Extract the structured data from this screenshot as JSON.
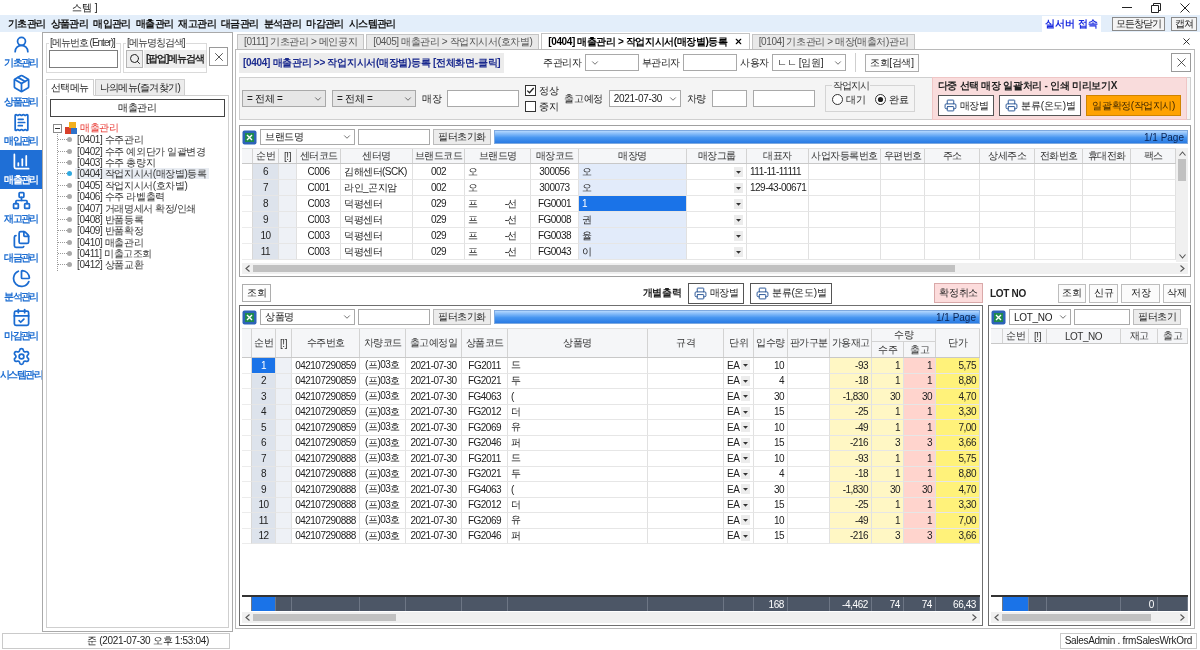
{
  "window": {
    "title": "스템 ]"
  },
  "menu_bar": {
    "items": [
      "기초관리",
      "상품관리",
      "매입관리",
      "매출관리",
      "재고관리",
      "대금관리",
      "분석관리",
      "마감관리",
      "시스템관리"
    ],
    "server_status": "실서버 접속",
    "buttons": [
      "모든창닫기",
      "캡쳐"
    ]
  },
  "nav_rail": [
    {
      "label": "기초관리",
      "selected": false
    },
    {
      "label": "상품관리",
      "selected": false
    },
    {
      "label": "매입관리",
      "selected": false
    },
    {
      "label": "매출관리",
      "selected": true
    },
    {
      "label": "재고관리",
      "selected": false
    },
    {
      "label": "대금관리",
      "selected": false
    },
    {
      "label": "분석관리",
      "selected": false
    },
    {
      "label": "마감관리",
      "selected": false
    },
    {
      "label": "시스템관리",
      "selected": false
    }
  ],
  "menu_panel": {
    "number_search": {
      "legend": "[메뉴번호 (Enter)]"
    },
    "name_search": {
      "legend": "[메뉴명칭검색]",
      "button": "[팝업]메뉴검색"
    },
    "tabs": [
      {
        "label": "선택메뉴",
        "selected": true
      },
      {
        "label": "나의메뉴(즐겨찾기)",
        "selected": false
      }
    ],
    "group_button": "매출관리",
    "tree": {
      "label": "매출관리",
      "expanded": true,
      "children": [
        {
          "label": "[0401] 수주관리",
          "selected": false
        },
        {
          "label": "[0402] 수주 예외단가 일괄변경",
          "selected": false
        },
        {
          "label": "[0403] 수주 총량지",
          "selected": false
        },
        {
          "label": "[0404] 작업지시서(매장별)등록",
          "selected": true
        },
        {
          "label": "[0405] 작업지시서(호차별)",
          "selected": false
        },
        {
          "label": "[0406] 수주 라벨출력",
          "selected": false
        },
        {
          "label": "[0407] 거래명세서 확정/인쇄",
          "selected": false
        },
        {
          "label": "[0408] 반품등록",
          "selected": false
        },
        {
          "label": "[0409] 반품확정",
          "selected": false
        },
        {
          "label": "[0410] 매출관리",
          "selected": false
        },
        {
          "label": "[0411] 미출고조회",
          "selected": false
        },
        {
          "label": "[0412] 상품교환",
          "selected": false
        }
      ]
    }
  },
  "doc_tabs": [
    {
      "label": "[0111] 기초관리 > 메인공지",
      "selected": false
    },
    {
      "label": "[0405] 매출관리 > 작업지시서(호차별)",
      "selected": false
    },
    {
      "label": "[0404] 매출관리 > 작업지시서(매장별)등록",
      "selected": true
    },
    {
      "label": "[0104] 기초관리 > 매장(매출처)관리",
      "selected": false
    }
  ],
  "form_header": {
    "title": "[0404] 매출관리 >> 작업지시서(매장별)등록 [전체화면-클릭]",
    "main_manager_label": "주관리자",
    "sub_manager_label": "부관리자",
    "user": {
      "label": "사용자",
      "value": "ㄴㄴ [임원]"
    },
    "search_button": "조회[검색]"
  },
  "filters": {
    "selects": [
      "= 전체 =",
      "= 전체 ="
    ],
    "store_label": "매장",
    "status": [
      {
        "label": "정상",
        "checked": true
      },
      {
        "label": "중지",
        "checked": false
      }
    ],
    "ship_date": {
      "label": "출고예정",
      "value": "2021-07-30"
    },
    "vehicle_label": "차량",
    "work_order": {
      "legend": "작업지시",
      "options": [
        {
          "label": "대기",
          "selected": false
        },
        {
          "label": "완료",
          "selected": true
        }
      ]
    }
  },
  "batch_panel": {
    "title": "다중 선택 매장 일괄처리 - 인쇄 미리보기X",
    "buttons": [
      {
        "label": "매장별",
        "kind": "print"
      },
      {
        "label": "분류(온도)별",
        "kind": "print"
      },
      {
        "label": "일괄확정(작업지시)",
        "kind": "confirm"
      }
    ]
  },
  "store_grid": {
    "filter_field": "브랜드명",
    "reset_button": "필터초기화",
    "page": "1/1 Page",
    "columns": [
      {
        "label": "순번",
        "kind": "index",
        "current": false
      },
      {
        "label": "[!]",
        "kind": "flag",
        "current": false
      },
      {
        "label": "센터코드",
        "kind": "code",
        "current": false
      },
      {
        "label": "센터명",
        "kind": "text",
        "current": false
      },
      {
        "label": "브랜드코드",
        "kind": "code",
        "current": false
      },
      {
        "label": "브랜드명",
        "kind": "text",
        "current": false
      },
      {
        "label": "매장코드",
        "kind": "code",
        "current": false
      },
      {
        "label": "매장명",
        "kind": "text",
        "current": true
      },
      {
        "label": "매장그룹",
        "kind": "dropdown",
        "current": false
      },
      {
        "label": "대표자",
        "kind": "text",
        "current": false
      },
      {
        "label": "사업자등록번호",
        "kind": "text",
        "current": false
      },
      {
        "label": "우편번호",
        "kind": "text",
        "current": false
      },
      {
        "label": "주소",
        "kind": "text",
        "current": false
      },
      {
        "label": "상세주소",
        "kind": "text",
        "current": false
      },
      {
        "label": "전화번호",
        "kind": "text",
        "current": false
      },
      {
        "label": "휴대전화",
        "kind": "text",
        "current": false
      },
      {
        "label": "팩스",
        "kind": "text",
        "current": false
      }
    ],
    "rows": [
      {
        "selected": false,
        "cells": [
          "6",
          null,
          "C006",
          "김해센터(SCK)",
          "002",
          "오",
          "300056",
          "오",
          null,
          "111-11-11111"
        ]
      },
      {
        "selected": false,
        "cells": [
          "7",
          null,
          "C001",
          "라인_곤지암",
          "002",
          "오",
          "300073",
          "오",
          null,
          "129-43-00671"
        ]
      },
      {
        "selected": true,
        "cells": [
          "8",
          null,
          "C003",
          "덕평센터",
          "029",
          {
            "text": "프",
            "tail": "-선"
          },
          "FG0001",
          "1"
        ]
      },
      {
        "selected": false,
        "cells": [
          "9",
          null,
          "C003",
          "덕평센터",
          "029",
          {
            "text": "프",
            "tail": "-선"
          },
          "FG0008",
          "권"
        ]
      },
      {
        "selected": false,
        "cells": [
          "10",
          null,
          "C003",
          "덕평센터",
          "029",
          {
            "text": "프",
            "tail": "-선"
          },
          "FG0038",
          "율"
        ]
      },
      {
        "selected": false,
        "cells": [
          "11",
          null,
          "C003",
          "덕평센터",
          "029",
          {
            "text": "프",
            "tail": "-선"
          },
          "FG0043",
          "이"
        ]
      }
    ]
  },
  "order_actions": {
    "query_button": "조회",
    "print_label": "개별출력",
    "print_buttons": [
      "매장별",
      "분류(온도)별"
    ],
    "cancel_button": "확정취소"
  },
  "order_grid": {
    "filter_field": "상품명",
    "reset_button": "필터초기화",
    "page": "1/1 Page",
    "column_group": {
      "label": "수량"
    },
    "columns": [
      {
        "label": "순번",
        "kind": "index",
        "current": true
      },
      {
        "label": "[!]",
        "kind": "flag",
        "current": false
      },
      {
        "label": "수주번호",
        "kind": "code",
        "current": false
      },
      {
        "label": "차량코드",
        "kind": "code",
        "current": false
      },
      {
        "label": "출고예정일",
        "kind": "code",
        "current": false
      },
      {
        "label": "상품코드",
        "kind": "code",
        "current": false
      },
      {
        "label": "상품명",
        "kind": "text",
        "current": false
      },
      {
        "label": "규격",
        "kind": "text",
        "current": false
      },
      {
        "label": "단위",
        "kind": "dropdown",
        "current": false
      },
      {
        "label": "입수량",
        "kind": "number",
        "current": false,
        "total": "168"
      },
      {
        "label": "판가구분",
        "kind": "text",
        "current": false
      },
      {
        "label": "가용재고",
        "kind": "stock",
        "current": false,
        "total": "-4,462"
      },
      {
        "label": "수주",
        "kind": "order",
        "current": false,
        "grouped": true,
        "total": "74"
      },
      {
        "label": "출고",
        "kind": "ship",
        "current": false,
        "grouped": true,
        "total": "74"
      },
      {
        "label": "단가",
        "kind": "price",
        "current": false,
        "total": "66,43"
      }
    ],
    "rows": [
      {
        "selected": true,
        "cells": [
          "1",
          null,
          "042107290859",
          "(프)03호",
          "2021-07-30",
          "FG2011",
          "드",
          null,
          "EA",
          "10",
          null,
          "-93",
          "1",
          "1",
          "5,75"
        ]
      },
      {
        "selected": false,
        "cells": [
          "2",
          null,
          "042107290859",
          "(프)03호",
          "2021-07-30",
          "FG2021",
          "두",
          null,
          "EA",
          "4",
          null,
          "-18",
          "1",
          "1",
          "8,80"
        ]
      },
      {
        "selected": false,
        "cells": [
          "3",
          null,
          "042107290859",
          "(프)03호",
          "2021-07-30",
          "FG4063",
          "(",
          null,
          "EA",
          "30",
          null,
          "-1,830",
          "30",
          "30",
          "4,70"
        ]
      },
      {
        "selected": false,
        "cells": [
          "4",
          null,
          "042107290859",
          "(프)03호",
          "2021-07-30",
          "FG2012",
          "더",
          null,
          "EA",
          "15",
          null,
          "-25",
          "1",
          "1",
          "3,30"
        ]
      },
      {
        "selected": false,
        "cells": [
          "5",
          null,
          "042107290859",
          "(프)03호",
          "2021-07-30",
          "FG2069",
          "유",
          null,
          "EA",
          "10",
          null,
          "-49",
          "1",
          "1",
          "7,00"
        ]
      },
      {
        "selected": false,
        "cells": [
          "6",
          null,
          "042107290859",
          "(프)03호",
          "2021-07-30",
          "FG2046",
          "퍼",
          null,
          "EA",
          "15",
          null,
          "-216",
          "3",
          "3",
          "3,66"
        ]
      },
      {
        "selected": false,
        "cells": [
          "7",
          null,
          "042107290888",
          "(프)03호",
          "2021-07-30",
          "FG2011",
          "드",
          null,
          "EA",
          "10",
          null,
          "-93",
          "1",
          "1",
          "5,75"
        ]
      },
      {
        "selected": false,
        "cells": [
          "8",
          null,
          "042107290888",
          "(프)03호",
          "2021-07-30",
          "FG2021",
          "두",
          null,
          "EA",
          "4",
          null,
          "-18",
          "1",
          "1",
          "8,80"
        ]
      },
      {
        "selected": false,
        "cells": [
          "9",
          null,
          "042107290888",
          "(프)03호",
          "2021-07-30",
          "FG4063",
          "(",
          null,
          "EA",
          "30",
          null,
          "-1,830",
          "30",
          "30",
          "4,70"
        ]
      },
      {
        "selected": false,
        "cells": [
          "10",
          null,
          "042107290888",
          "(프)03호",
          "2021-07-30",
          "FG2012",
          "더",
          null,
          "EA",
          "15",
          null,
          "-25",
          "1",
          "1",
          "3,30"
        ]
      },
      {
        "selected": false,
        "cells": [
          "11",
          null,
          "042107290888",
          "(프)03호",
          "2021-07-30",
          "FG2069",
          "유",
          null,
          "EA",
          "10",
          null,
          "-49",
          "1",
          "1",
          "7,00"
        ]
      },
      {
        "selected": false,
        "cells": [
          "12",
          null,
          "042107290888",
          "(프)03호",
          "2021-07-30",
          "FG2046",
          "퍼",
          null,
          "EA",
          "15",
          null,
          "-216",
          "3",
          "3",
          "3,66"
        ]
      }
    ]
  },
  "lot_panel": {
    "title": "LOT NO",
    "buttons": [
      "조회",
      "신규",
      "저장",
      "삭제"
    ],
    "grid": {
      "filter_field": "LOT_NO",
      "reset_button": "필터초기",
      "columns": [
        {
          "label": "순번",
          "current": true
        },
        {
          "label": "[!]",
          "current": false
        },
        {
          "label": "LOT_NO",
          "current": false
        },
        {
          "label": "재고",
          "current": false,
          "total": "0"
        },
        {
          "label": "출고",
          "current": false
        }
      ]
    }
  },
  "status_bar": {
    "timestamp": "준 (2021-07-30 오후 1:53:04)",
    "form_name": "SalesAdmin . frmSalesWrkOrd"
  }
}
